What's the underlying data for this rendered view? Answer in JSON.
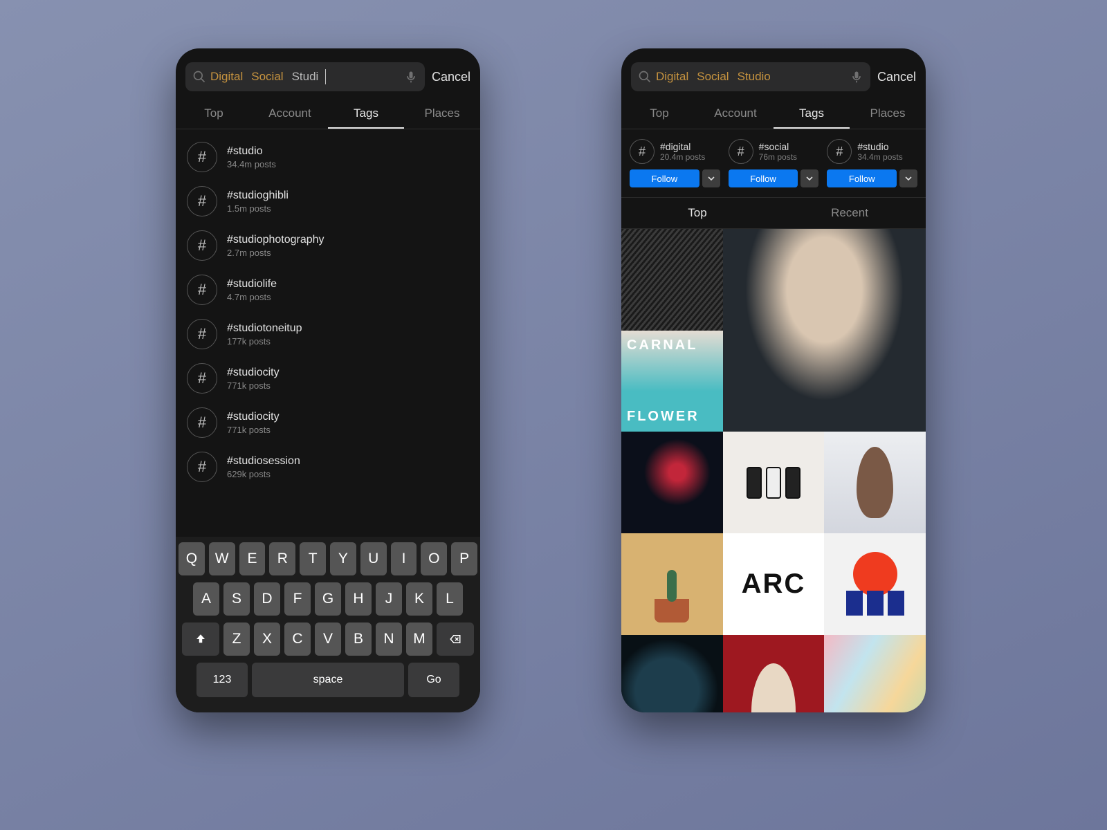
{
  "left": {
    "search": {
      "chips": [
        "Digital",
        "Social"
      ],
      "typing": "Studi",
      "cancel": "Cancel"
    },
    "tabs": [
      "Top",
      "Account",
      "Tags",
      "Places"
    ],
    "active_tab": 2,
    "results": [
      {
        "tag": "#studio",
        "posts": "34.4m posts"
      },
      {
        "tag": "#studioghibli",
        "posts": "1.5m posts"
      },
      {
        "tag": "#studiophotography",
        "posts": "2.7m posts"
      },
      {
        "tag": "#studiolife",
        "posts": "4.7m posts"
      },
      {
        "tag": "#studiotoneitup",
        "posts": "177k posts"
      },
      {
        "tag": "#studiocity",
        "posts": "771k posts"
      },
      {
        "tag": "#studiocity",
        "posts": "771k posts"
      },
      {
        "tag": "#studiosession",
        "posts": "629k posts"
      }
    ],
    "keyboard": {
      "row1": [
        "Q",
        "W",
        "E",
        "R",
        "T",
        "Y",
        "U",
        "I",
        "O",
        "P"
      ],
      "row2": [
        "A",
        "S",
        "D",
        "F",
        "G",
        "H",
        "J",
        "K",
        "L"
      ],
      "row3": [
        "Z",
        "X",
        "C",
        "V",
        "B",
        "N",
        "M"
      ],
      "numKey": "123",
      "spaceKey": "space",
      "goKey": "Go"
    }
  },
  "right": {
    "search": {
      "chips": [
        "Digital",
        "Social",
        "Studio"
      ],
      "cancel": "Cancel"
    },
    "tabs": [
      "Top",
      "Account",
      "Tags",
      "Places"
    ],
    "active_tab": 2,
    "follow": [
      {
        "tag": "#digital",
        "posts": "20.4m posts",
        "btn": "Follow"
      },
      {
        "tag": "#social",
        "posts": "76m posts",
        "btn": "Follow"
      },
      {
        "tag": "#studio",
        "posts": "34.4m posts",
        "btn": "Follow"
      }
    ],
    "subTabs": [
      "Top",
      "Recent"
    ],
    "active_sub": 0,
    "grid_text": {
      "carnal_top": "CARNAL",
      "carnal_bottom": "FLOWER",
      "arc": "ARC"
    }
  }
}
